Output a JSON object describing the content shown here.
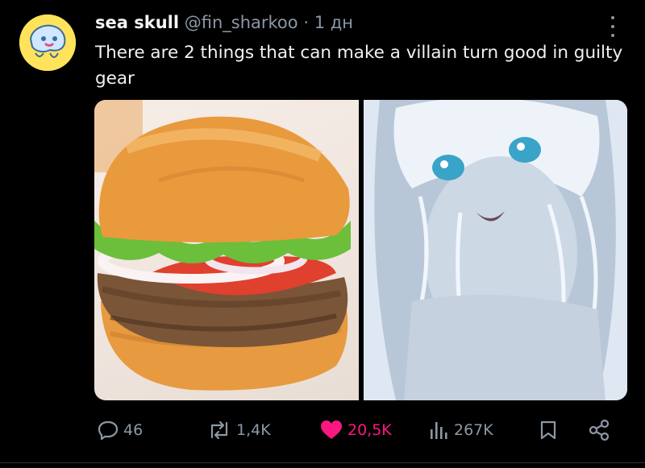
{
  "post": {
    "display_name": "sea skull",
    "handle": "@fin_sharkoo",
    "separator": "·",
    "time": "1 дн",
    "text": "There are 2 things that can make a villain turn good in guilty gear"
  },
  "media": {
    "left_image": "burger-photo",
    "right_image": "anime-girl-illustration"
  },
  "actions": {
    "replies": "46",
    "reposts": "1,4K",
    "likes": "20,5K",
    "views": "267K"
  },
  "colors": {
    "background": "#000000",
    "text": "#e7e9ea",
    "muted": "#8b98a5",
    "like": "#f91880",
    "avatar_bg": "#ffe35a"
  },
  "icons": [
    "reply-icon",
    "repost-icon",
    "heart-icon",
    "views-icon",
    "bookmark-icon",
    "share-icon",
    "more-icon"
  ]
}
